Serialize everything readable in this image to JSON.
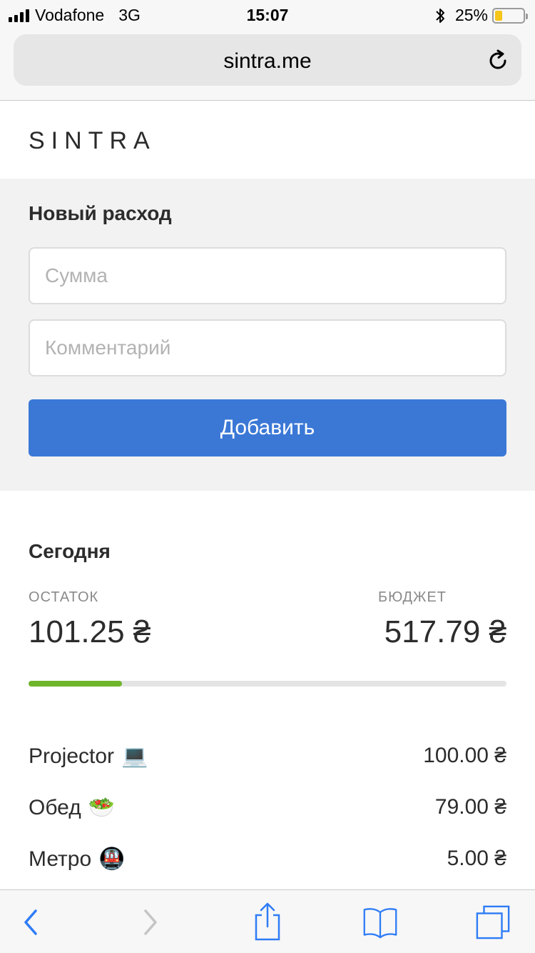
{
  "status_bar": {
    "carrier": "Vodafone",
    "network": "3G",
    "time": "15:07",
    "battery_percent": "25%",
    "battery_level": 0.25,
    "signal_bars": 4
  },
  "browser": {
    "url": "sintra.me"
  },
  "logo": "SINTRA",
  "form": {
    "title": "Новый расход",
    "amount_placeholder": "Сумма",
    "amount_value": "",
    "comment_placeholder": "Комментарий",
    "comment_value": "",
    "submit_label": "Добавить"
  },
  "today": {
    "title": "Сегодня",
    "remaining_label": "ОСТАТОК",
    "remaining_value": "101.25 ₴",
    "budget_label": "БЮДЖЕТ",
    "budget_value": "517.79 ₴",
    "progress_fraction": 0.195
  },
  "expenses": [
    {
      "name": "Projector",
      "emoji": "💻",
      "amount": "100.00 ₴"
    },
    {
      "name": "Обед",
      "emoji": "🥗",
      "amount": "79.00 ₴"
    },
    {
      "name": "Метро",
      "emoji": "🚇",
      "amount": "5.00 ₴"
    }
  ],
  "colors": {
    "accent": "#3b78d6",
    "progress": "#6fb52c",
    "battery": "#f5c518",
    "ios_blue": "#2f7cf6"
  },
  "icons": [
    "signal-icon",
    "bluetooth-icon",
    "battery-icon",
    "reload-icon",
    "back-icon",
    "forward-icon",
    "share-icon",
    "bookmarks-icon",
    "tabs-icon"
  ]
}
